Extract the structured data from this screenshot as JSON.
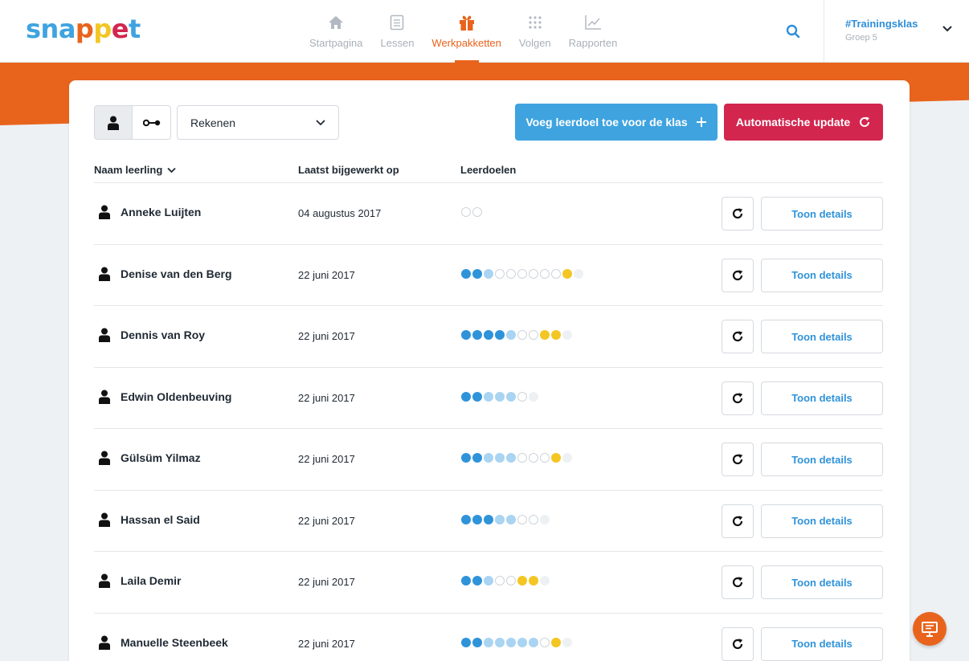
{
  "app": {
    "logo_letters": [
      {
        "ch": "s",
        "color": "#3fa3e0"
      },
      {
        "ch": "n",
        "color": "#3fa3e0"
      },
      {
        "ch": "a",
        "color": "#3fa3e0"
      },
      {
        "ch": "p",
        "color": "#e8641d"
      },
      {
        "ch": "p",
        "color": "#f3c623"
      },
      {
        "ch": "e",
        "color": "#d2264f"
      },
      {
        "ch": "t",
        "color": "#3fa3e0"
      }
    ]
  },
  "nav": {
    "items": [
      {
        "label": "Startpagina",
        "icon": "home-icon",
        "active": false
      },
      {
        "label": "Lessen",
        "icon": "lessons-icon",
        "active": false
      },
      {
        "label": "Werkpakketten",
        "icon": "gift-icon",
        "active": true
      },
      {
        "label": "Volgen",
        "icon": "grid-icon",
        "active": false
      },
      {
        "label": "Rapporten",
        "icon": "chart-icon",
        "active": false
      }
    ]
  },
  "header": {
    "class_name": "#Trainingsklas",
    "group": "Groep 5"
  },
  "toolbar": {
    "subject": "Rekenen",
    "add_goal_label": "Voeg leerdoel toe voor de klas",
    "auto_update_label": "Automatische update"
  },
  "table": {
    "col_name": "Naam leerling",
    "col_date": "Laatst bijgewerkt op",
    "col_goals": "Leerdoelen",
    "details_label": "Toon details",
    "rows": [
      {
        "name": "Anneke Luijten",
        "date": "04 augustus 2017",
        "goals": [
          "empty",
          "empty"
        ]
      },
      {
        "name": "Denise van den Berg",
        "date": "22 juni 2017",
        "goals": [
          "full",
          "full",
          "light",
          "empty",
          "empty",
          "empty",
          "empty",
          "empty",
          "empty",
          "gold",
          "faint"
        ]
      },
      {
        "name": "Dennis van Roy",
        "date": "22 juni 2017",
        "goals": [
          "full",
          "full",
          "full",
          "full",
          "light",
          "empty",
          "empty",
          "gold",
          "gold",
          "faint"
        ]
      },
      {
        "name": "Edwin Oldenbeuving",
        "date": "22 juni 2017",
        "goals": [
          "full",
          "full",
          "light",
          "light",
          "light",
          "empty",
          "faint"
        ]
      },
      {
        "name": "Gülsüm Yilmaz",
        "date": "22 juni 2017",
        "goals": [
          "full",
          "full",
          "light",
          "light",
          "light",
          "empty",
          "empty",
          "empty",
          "gold",
          "faint"
        ]
      },
      {
        "name": "Hassan el Said",
        "date": "22 juni 2017",
        "goals": [
          "full",
          "full",
          "full",
          "light",
          "light",
          "empty",
          "empty",
          "faint"
        ]
      },
      {
        "name": "Laila Demir",
        "date": "22 juni 2017",
        "goals": [
          "full",
          "full",
          "light",
          "empty",
          "empty",
          "gold",
          "gold",
          "faint"
        ]
      },
      {
        "name": "Manuelle Steenbeek",
        "date": "22 juni 2017",
        "goals": [
          "full",
          "full",
          "light",
          "light",
          "light",
          "light",
          "light",
          "empty",
          "gold",
          "faint"
        ]
      }
    ]
  },
  "colors": {
    "accent_orange": "#e8641d",
    "accent_blue": "#3fa3e0",
    "accent_red": "#d2264f",
    "goal_gold": "#f3c623"
  }
}
